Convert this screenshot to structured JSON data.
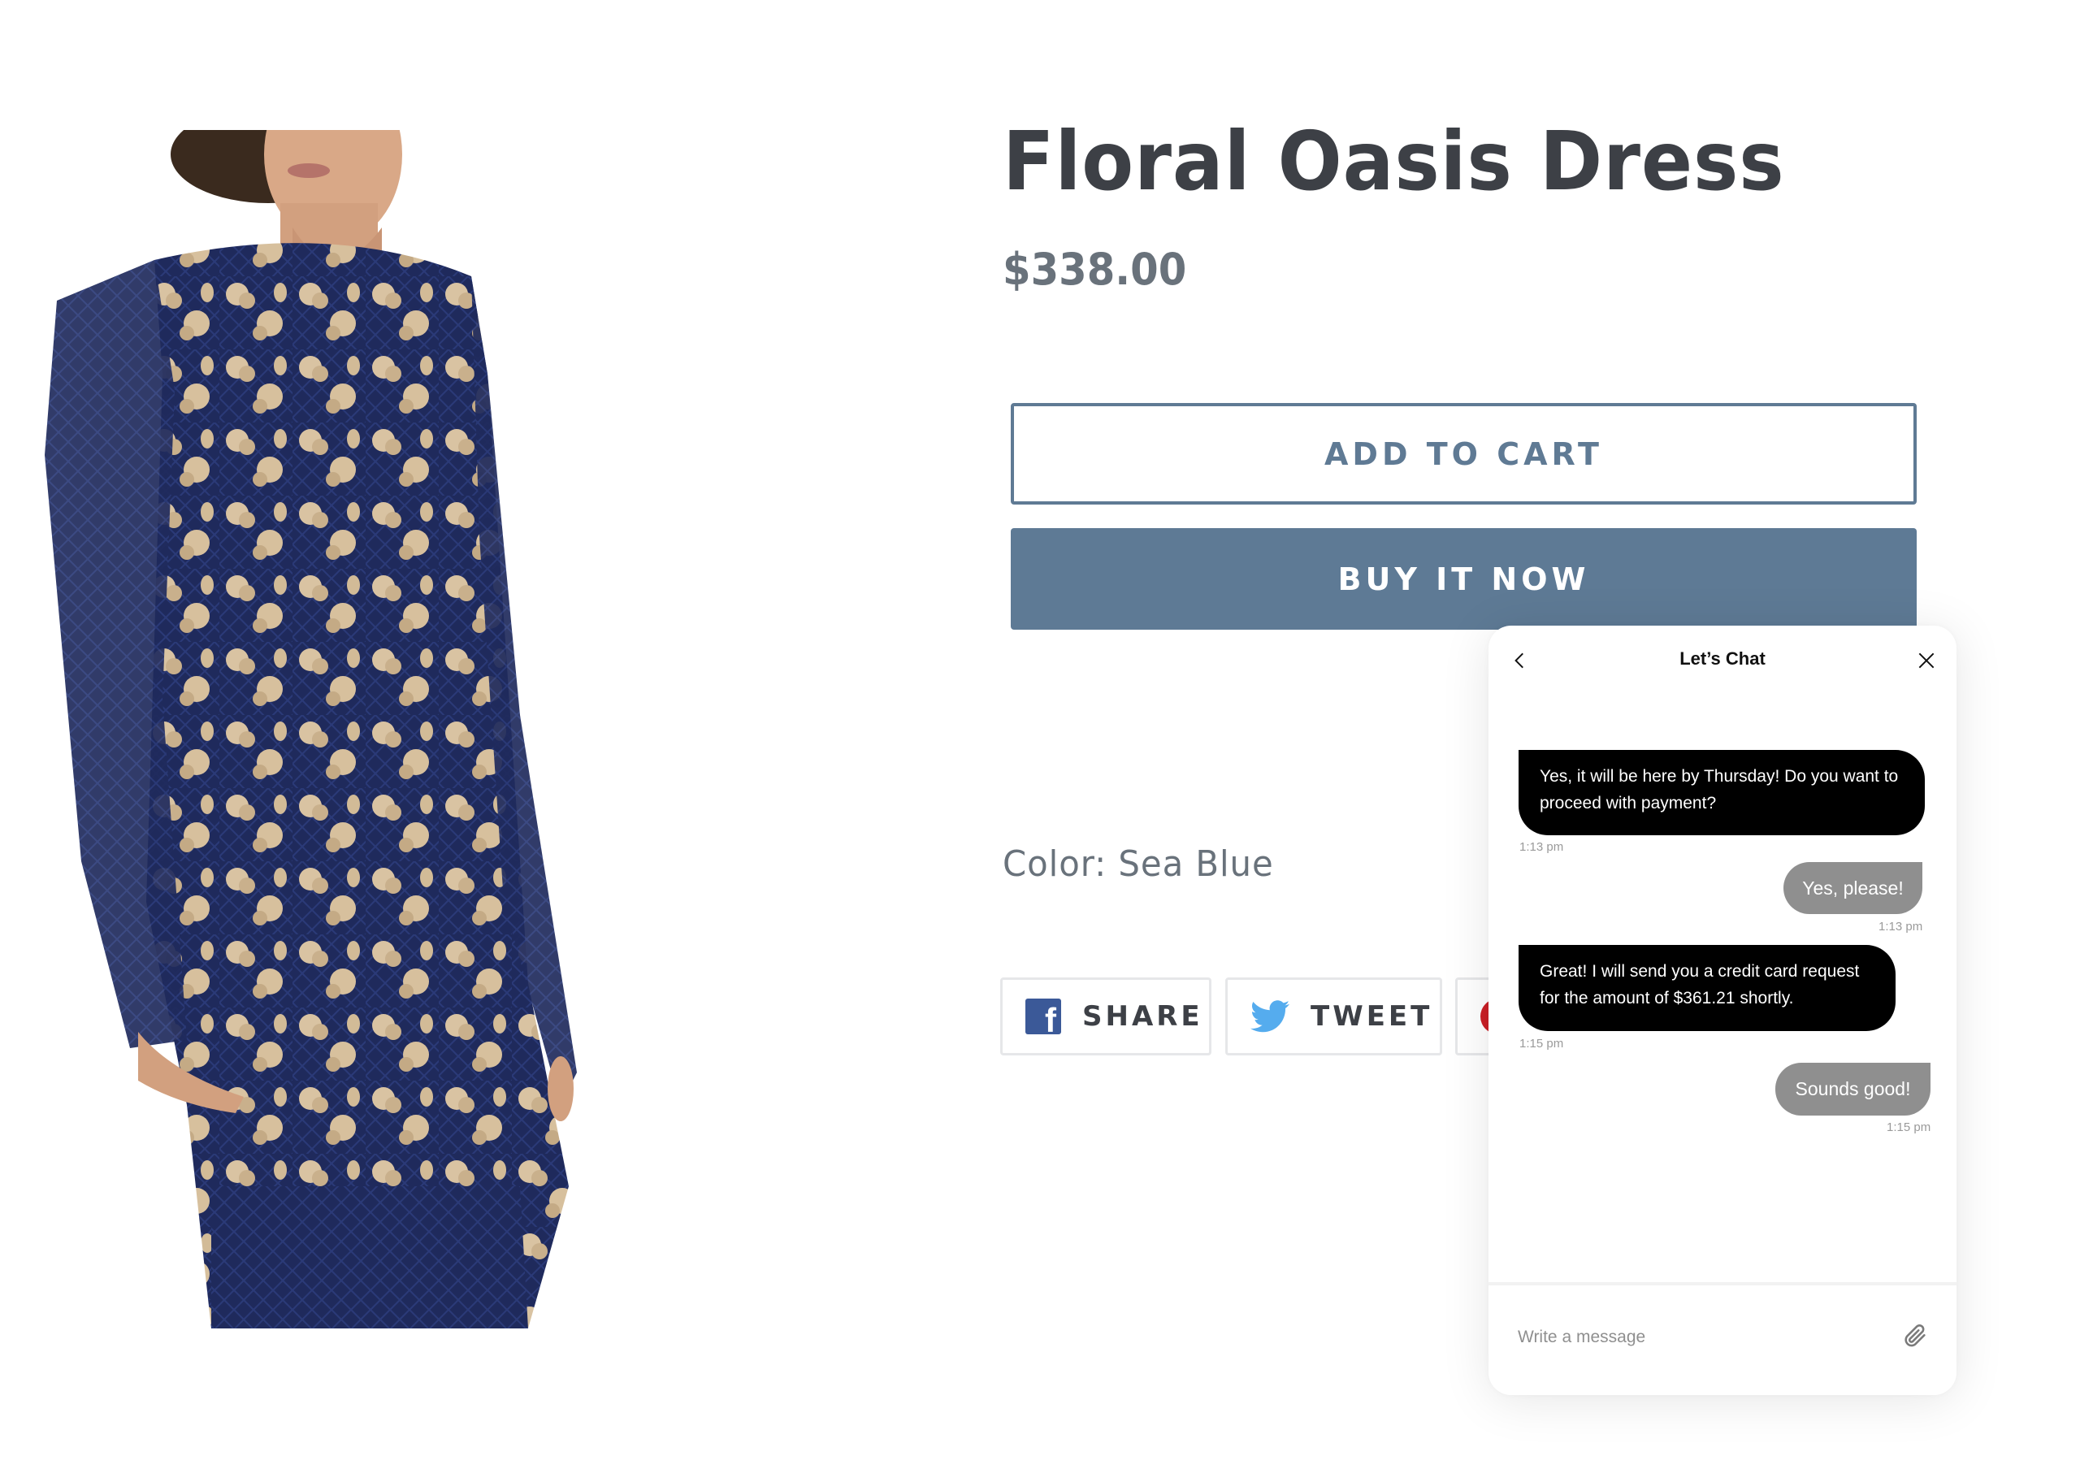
{
  "product": {
    "image_alt": "Model wearing navy lace dress with gold floral embroidery",
    "title": "Floral Oasis Dress",
    "price": "$338.00",
    "color_label": "Color: Sea Blue"
  },
  "actions": {
    "add_to_cart": "ADD TO CART",
    "buy_now": "BUY IT NOW"
  },
  "share": {
    "facebook": {
      "label": "SHARE",
      "icon": "facebook-icon",
      "color": "#3b5998"
    },
    "twitter": {
      "label": "TWEET",
      "icon": "twitter-icon",
      "color": "#55acee"
    },
    "pinterest": {
      "label": "",
      "icon": "pinterest-icon",
      "color": "#cb2027"
    }
  },
  "chat": {
    "title": "Let’s Chat",
    "back_icon": "chevron-left-icon",
    "close_icon": "close-icon",
    "messages": [
      {
        "from": "agent",
        "text": "Yes, it will be here by Thursday! Do you want to proceed with payment?",
        "time": "1:13 pm"
      },
      {
        "from": "user",
        "text": "Yes, please!",
        "time": "1:13 pm"
      },
      {
        "from": "agent",
        "text": "Great! I will send you a credit card request for the amount of $361.21 shortly.",
        "time": "1:15 pm"
      },
      {
        "from": "user",
        "text": "Sounds good!",
        "time": "1:15 pm"
      }
    ],
    "input": {
      "value": "",
      "placeholder": "Write a message"
    },
    "attach_icon": "paperclip-icon"
  },
  "colors": {
    "accent": "#5e7a95",
    "title": "#3d4046",
    "muted": "#69727b",
    "agent_bubble": "#000000",
    "user_bubble": "#8f8f8f"
  }
}
